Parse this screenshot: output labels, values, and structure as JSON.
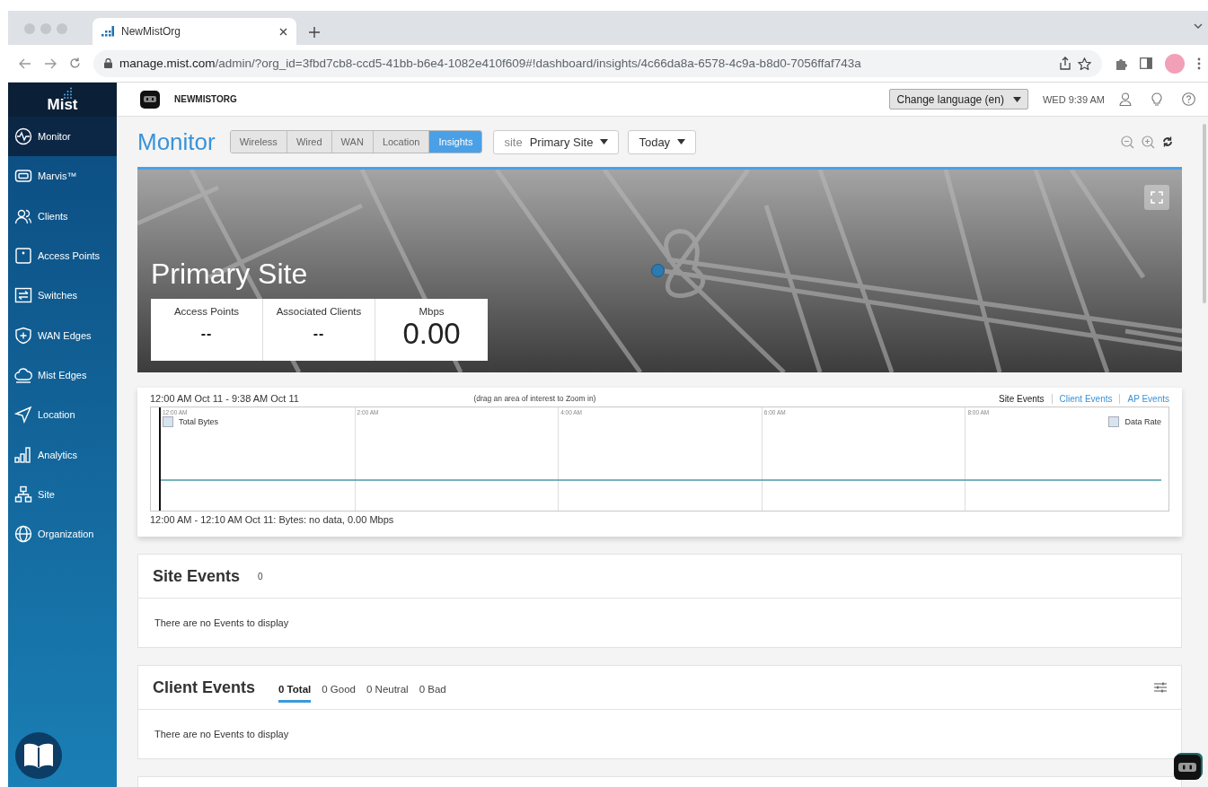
{
  "browser": {
    "tab_title": "NewMistOrg",
    "url_host": "manage.mist.com",
    "url_rest": "/admin/?org_id=3fbd7cb8-ccd5-41bb-b6e4-1082e410f609#!dashboard/insights/4c66da8a-6578-4c9a-b8d0-7056ffaf743a"
  },
  "sidebar": {
    "logo": "Mist",
    "items": [
      {
        "label": "Monitor",
        "kind": "monitor",
        "selected": true
      },
      {
        "label": "Marvis™",
        "kind": "marvis",
        "selected": false
      },
      {
        "label": "Clients",
        "kind": "clients",
        "selected": false
      },
      {
        "label": "Access Points",
        "kind": "accesspoints",
        "selected": false
      },
      {
        "label": "Switches",
        "kind": "switches",
        "selected": false
      },
      {
        "label": "WAN Edges",
        "kind": "wanedges",
        "selected": false
      },
      {
        "label": "Mist Edges",
        "kind": "mistedges",
        "selected": false
      },
      {
        "label": "Location",
        "kind": "location",
        "selected": false
      },
      {
        "label": "Analytics",
        "kind": "analytics",
        "selected": false
      },
      {
        "label": "Site",
        "kind": "site",
        "selected": false
      },
      {
        "label": "Organization",
        "kind": "organization",
        "selected": false
      }
    ]
  },
  "header": {
    "org_name": "NEWMISTORG",
    "language_select": "Change language (en)",
    "datetime": "WED 9:39 AM"
  },
  "toolbar": {
    "title": "Monitor",
    "tabs": [
      {
        "label": "Wireless",
        "selected": false
      },
      {
        "label": "Wired",
        "selected": false
      },
      {
        "label": "WAN",
        "selected": false
      },
      {
        "label": "Location",
        "selected": false
      },
      {
        "label": "Insights",
        "selected": true
      }
    ],
    "site_select": {
      "prefix": "site",
      "value": "Primary Site"
    },
    "period_select": "Today"
  },
  "site_summary": {
    "site_name": "Primary Site",
    "stats": [
      {
        "label": "Access Points",
        "value": "--"
      },
      {
        "label": "Associated Clients",
        "value": "--"
      },
      {
        "label": "Mbps",
        "value": "0.00"
      }
    ]
  },
  "timeline": {
    "range": "12:00 AM Oct 11 - 9:38 AM Oct 11",
    "hint": "(drag an area of interest to Zoom in)",
    "event_links": [
      {
        "label": "Site Events",
        "selected": true
      },
      {
        "label": "Client Events",
        "selected": false
      },
      {
        "label": "AP Events",
        "selected": false
      }
    ],
    "time_labels": [
      "12:00 AM",
      "2:00 AM",
      "4:00 AM",
      "6:00 AM",
      "8:00 AM"
    ],
    "legend": [
      {
        "label": "Total Bytes"
      },
      {
        "label": "Data Rate"
      }
    ],
    "status": "12:00 AM - 12:10 AM Oct 11: Bytes: no data, 0.00 Mbps"
  },
  "site_events": {
    "title": "Site Events",
    "count": "0",
    "empty_message": "There are no Events to display"
  },
  "client_events": {
    "title": "Client Events",
    "filters": [
      {
        "label": "0 Total",
        "selected": true
      },
      {
        "label": "0 Good",
        "selected": false
      },
      {
        "label": "0 Neutral",
        "selected": false
      },
      {
        "label": "0 Bad",
        "selected": false
      }
    ],
    "empty_message": "There are no Events to display"
  }
}
